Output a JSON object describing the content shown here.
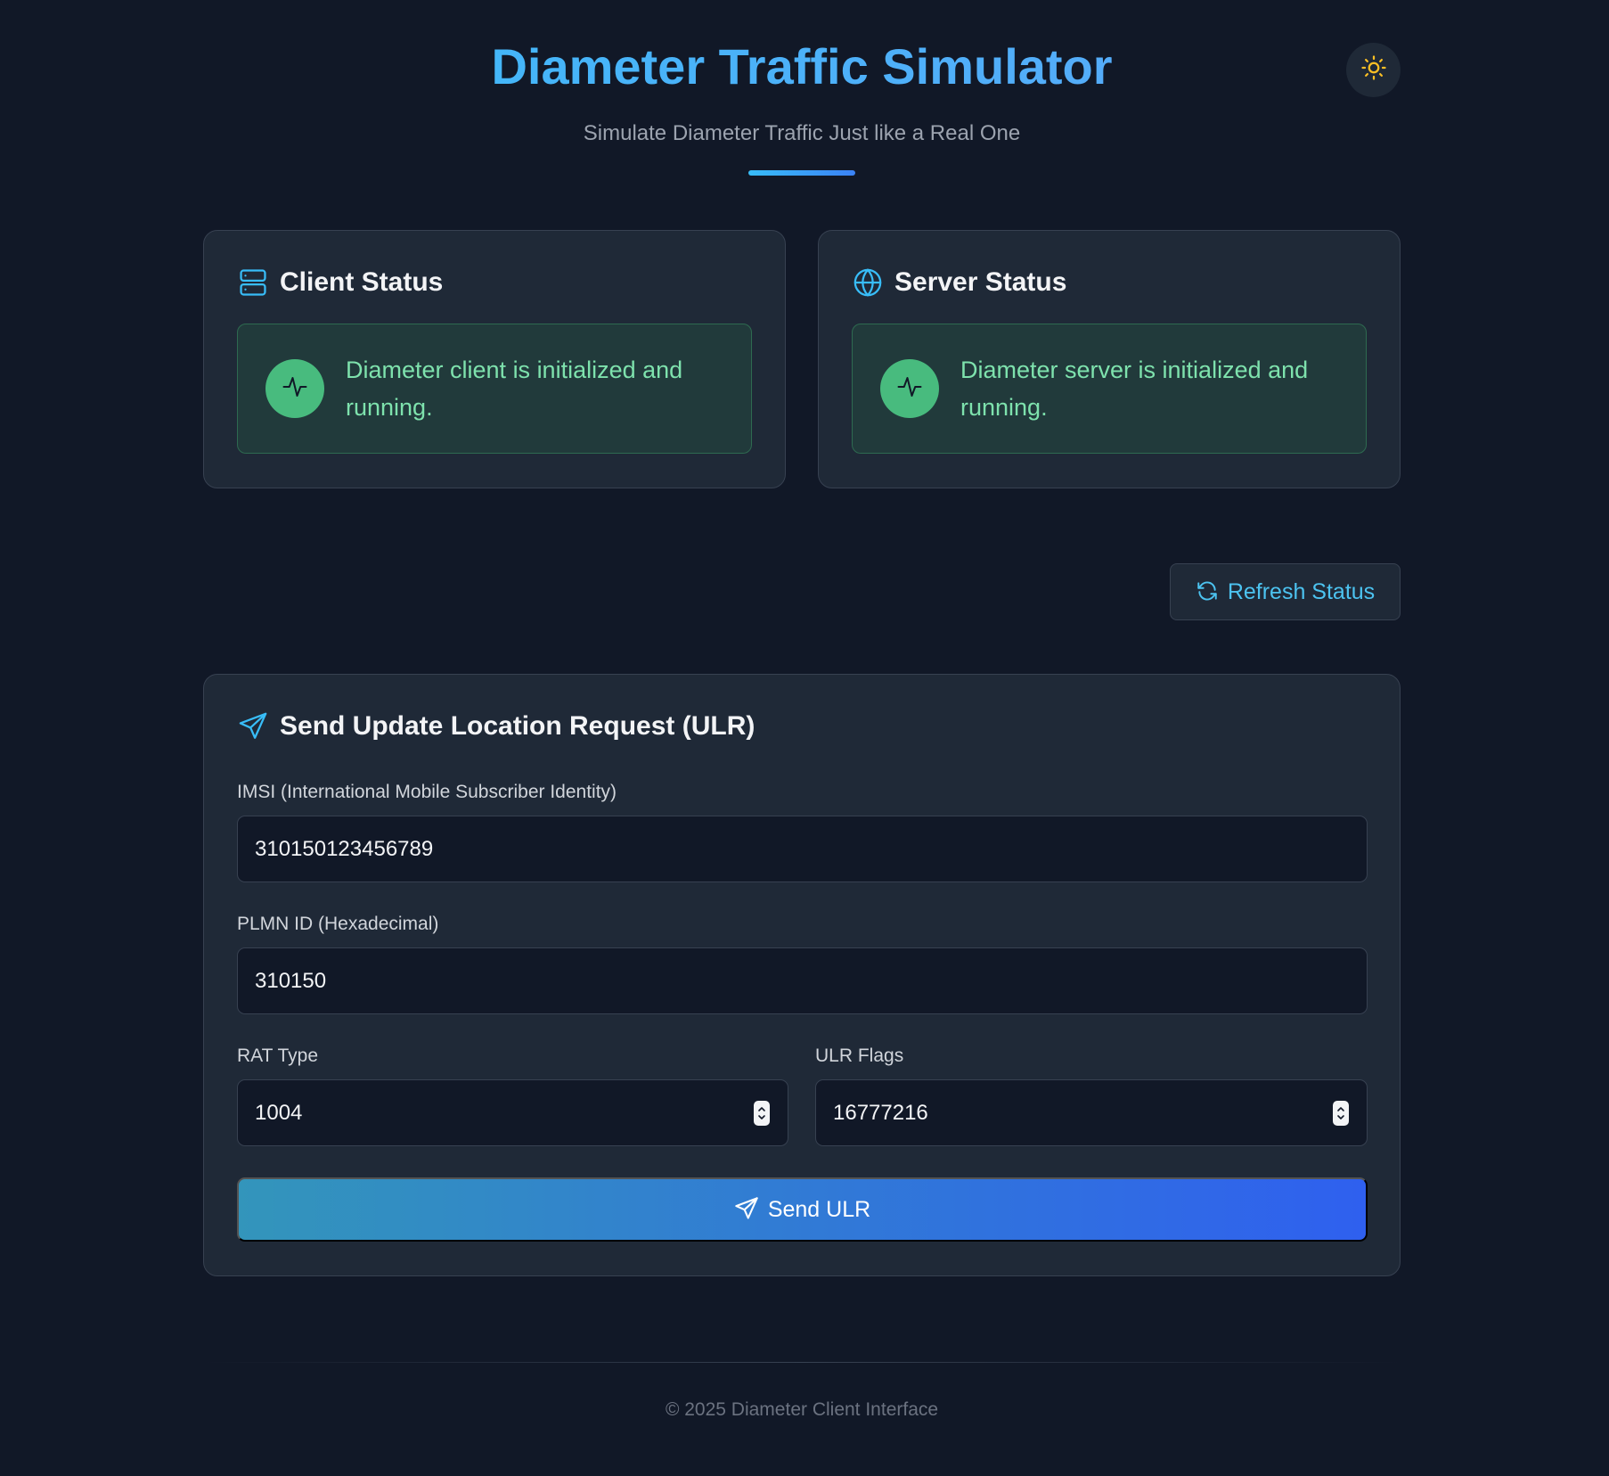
{
  "header": {
    "title": "Diameter Traffic Simulator",
    "subtitle": "Simulate Diameter Traffic Just like a Real One",
    "theme_toggle_icon": "sun-icon"
  },
  "client_status": {
    "title": "Client Status",
    "icon": "server-icon",
    "message_line1": "Diameter client is initialized and",
    "message_line2": "running.",
    "status_icon": "activity-icon"
  },
  "server_status": {
    "title": "Server Status",
    "icon": "globe-icon",
    "message_line1": "Diameter server is initialized and",
    "message_line2": "running.",
    "status_icon": "activity-icon"
  },
  "refresh": {
    "label": "Refresh Status",
    "icon": "refresh-icon"
  },
  "ulr_form": {
    "title": "Send Update Location Request (ULR)",
    "icon": "send-icon",
    "imsi": {
      "label": "IMSI (International Mobile Subscriber Identity)",
      "value": "310150123456789"
    },
    "plmn": {
      "label": "PLMN ID (Hexadecimal)",
      "value": "310150"
    },
    "rat_type": {
      "label": "RAT Type",
      "value": "1004"
    },
    "ulr_flags": {
      "label": "ULR Flags",
      "value": "16777216"
    },
    "submit_label": "Send ULR"
  },
  "footer": {
    "text": "© 2025 Diameter Client Interface"
  },
  "colors": {
    "background": "#111827",
    "card": "#1f2937",
    "accent": "#38bdf8",
    "success": "#48bb7e",
    "button_gradient_start": "#3395bb",
    "button_gradient_end": "#2f60ef"
  }
}
